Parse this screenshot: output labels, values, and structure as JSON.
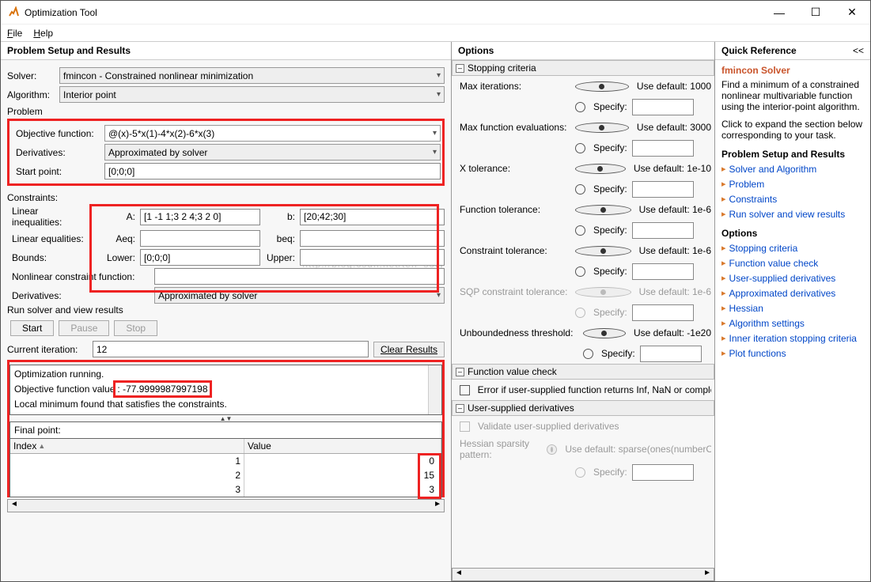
{
  "window": {
    "title": "Optimization Tool"
  },
  "menu": {
    "file": "File",
    "help": "Help"
  },
  "left": {
    "header": "Problem Setup and Results",
    "solver_label": "Solver:",
    "solver_value": "fmincon - Constrained nonlinear minimization",
    "algo_label": "Algorithm:",
    "algo_value": "Interior point",
    "problem_label": "Problem",
    "objfun_label": "Objective function:",
    "objfun_value": "@(x)-5*x(1)-4*x(2)-6*x(3)",
    "deriv_label": "Derivatives:",
    "deriv_value": "Approximated by solver",
    "start_label": "Start point:",
    "start_value": "[0;0;0]",
    "cons_label": "Constraints:",
    "linineq_label": "Linear inequalities:",
    "A_label": "A:",
    "A_value": "[1 -1 1;3 2 4;3 2 0]",
    "b_label": "b:",
    "b_value": "[20;42;30]",
    "lineq_label": "Linear equalities:",
    "Aeq_label": "Aeq:",
    "Aeq_value": "",
    "beq_label": "beq:",
    "beq_value": "",
    "bounds_label": "Bounds:",
    "lower_label": "Lower:",
    "lower_value": "[0;0;0]",
    "upper_label": "Upper:",
    "upper_value": "",
    "nlcon_label": "Nonlinear constraint function:",
    "nlcon_value": "",
    "deriv2_label": "Derivatives:",
    "deriv2_value": "Approximated by solver",
    "run_header": "Run solver and view results",
    "btn_start": "Start",
    "btn_pause": "Pause",
    "btn_stop": "Stop",
    "curiter_label": "Current iteration:",
    "curiter_value": "12",
    "clear_label": "Clear Results",
    "log1": "Optimization running.",
    "log2_pre": "Objective function value",
    "log2_val": ": -77.9999987997198",
    "log3": "Local minimum found that satisfies the constraints.",
    "finalpoint_label": "Final point:",
    "th_index": "Index",
    "th_value": "Value",
    "rows": [
      {
        "i": "1",
        "v": "0"
      },
      {
        "i": "2",
        "v": "15"
      },
      {
        "i": "3",
        "v": "3"
      }
    ]
  },
  "mid": {
    "header": "Options",
    "sec_stop": "Stopping criteria",
    "maxiter": "Max iterations:",
    "maxiter_def": "Use default: 1000",
    "specify": "Specify:",
    "maxfun": "Max function evaluations:",
    "maxfun_def": "Use default: 3000",
    "xtol": "X tolerance:",
    "xtol_def": "Use default: 1e-10",
    "ftol": "Function tolerance:",
    "ftol_def": "Use default: 1e-6",
    "ctol": "Constraint tolerance:",
    "ctol_def": "Use default: 1e-6",
    "sqp": "SQP constraint tolerance:",
    "sqp_def": "Use default: 1e-6",
    "unb": "Unboundedness threshold:",
    "unb_def": "Use default: -1e20",
    "sec_fvc": "Function value check",
    "fvc_chk": "Error if user-supplied function returns Inf, NaN or complex",
    "sec_usd": "User-supplied derivatives",
    "usd_chk": "Validate user-supplied derivatives",
    "hess_label": "Hessian sparsity pattern:",
    "hess_def": "Use default: sparse(ones(numberOfVariables))"
  },
  "right": {
    "header": "Quick Reference",
    "collapse": "<<",
    "title": "fmincon Solver",
    "desc": "Find a minimum of a constrained nonlinear multivariable function using the interior-point algorithm.",
    "expand": "Click to expand the section below corresponding to your task.",
    "h1": "Problem Setup and Results",
    "links1": [
      "Solver and Algorithm",
      "Problem",
      "Constraints",
      "Run solver and view results"
    ],
    "h2": "Options",
    "links2": [
      "Stopping criteria",
      "Function value check",
      "User-supplied derivatives",
      "Approximated derivatives",
      "Hessian",
      "Algorithm settings",
      "Inner iteration stopping criteria",
      "Plot functions"
    ]
  },
  "watermark": "http://blog.csdn.net/ten_sory"
}
